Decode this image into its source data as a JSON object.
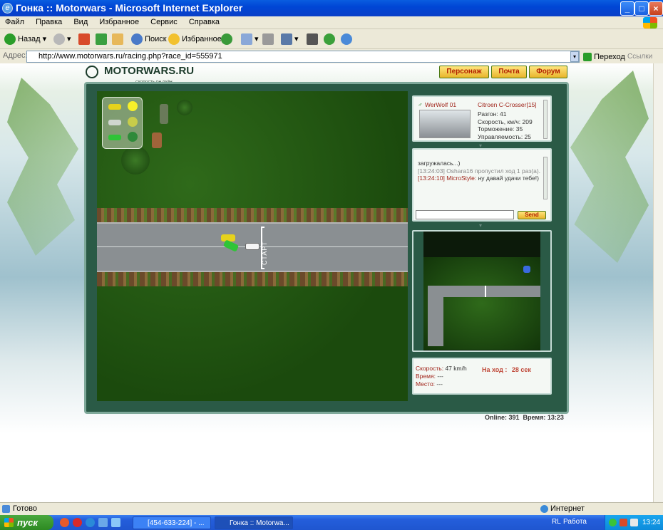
{
  "window": {
    "title": "Гонка :: Motorwars - Microsoft Internet Explorer",
    "icon": "ie-icon",
    "controls": [
      "minimize",
      "maximize",
      "close"
    ]
  },
  "menu": [
    "Файл",
    "Правка",
    "Вид",
    "Избранное",
    "Сервис",
    "Справка"
  ],
  "toolbar": {
    "back": "Назад",
    "search": "Поиск",
    "favorites": "Избранное"
  },
  "address": {
    "label": "Адрес:",
    "url": "http://www.motorwars.ru/racing.php?race_id=555971",
    "go": "Переход",
    "links": "Ссылки"
  },
  "site": {
    "logo": "MOTORWARS.RU",
    "tagline": "СКОРОСТЬ ОН-ЛАЙН",
    "nav": [
      "Персонаж",
      "Почта",
      "Форум"
    ]
  },
  "track": {
    "start_label": "СТАРТ"
  },
  "player": {
    "name": "WerWolf 01",
    "car": "Citroen C-Crosser[15]",
    "stats": [
      "Разгон: 41",
      "Скорость, км/ч: 209",
      "Торможение: 35",
      "Управляемость: 25"
    ]
  },
  "chat": {
    "lines": [
      {
        "time": "",
        "author": "",
        "text": "загружалась...)"
      },
      {
        "time": "[13:24:03]",
        "author": "",
        "text": "Oshara16 пропустил ход 1 раз(а)."
      },
      {
        "time": "[13:24:10]",
        "author": "MicroStyle:",
        "text": "ну давай удачи тебе!)"
      }
    ],
    "input_value": "",
    "send": "Send"
  },
  "race": {
    "speed_label": "Скорость:",
    "speed_value": "47 km/h",
    "time_label": "Время:",
    "time_value": "---",
    "place_label": "Место:",
    "place_value": "---",
    "turn_label": "На ход :",
    "turn_value": "28 сек"
  },
  "footer": {
    "online": "Online: 391",
    "time": "Время: 13:23"
  },
  "statusbar": {
    "text": "Готово",
    "zone": "Интернет"
  },
  "taskbar": {
    "start": "пуск",
    "tasks": [
      "[454-633-224] - ...",
      "Гонка :: Motorwa..."
    ],
    "lang": "RL",
    "work": "Работа",
    "clock": "13:24"
  },
  "colors": {
    "accent_red": "#a0241a",
    "button_yellow": "#e8b42a",
    "frame_green": "#2a5a46"
  }
}
